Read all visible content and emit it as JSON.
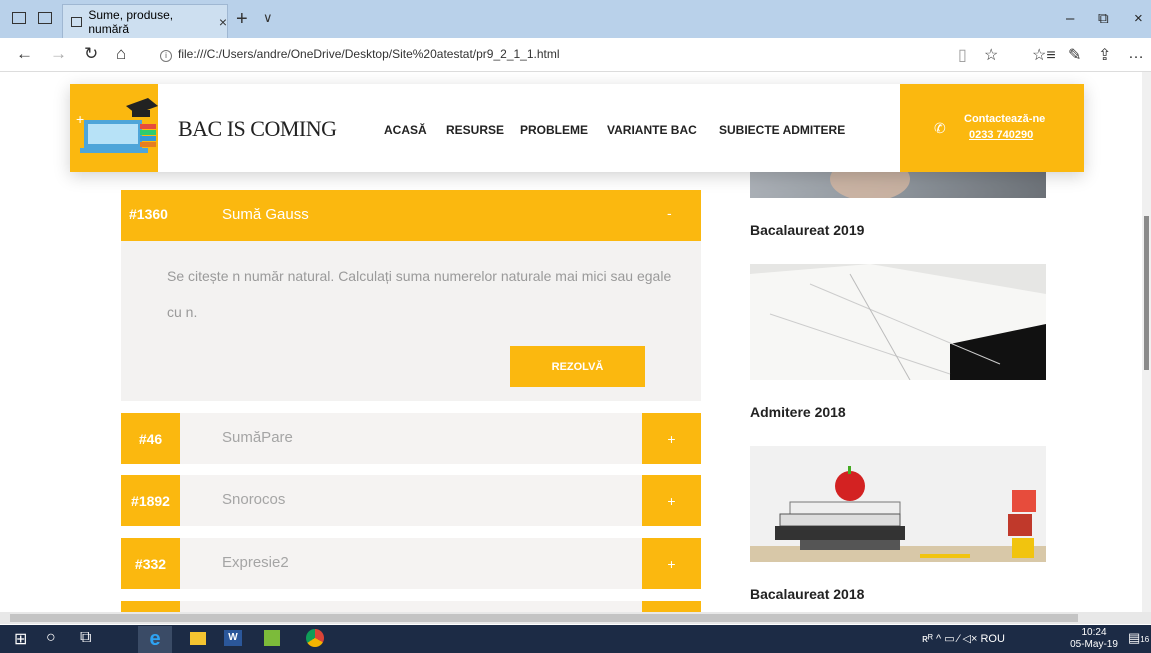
{
  "browser": {
    "tab_title": "Sume, produse, numără",
    "tab_close": "×",
    "new_tab": "+",
    "tab_menu": "∨",
    "url": "file:///C:/Users/andre/OneDrive/Desktop/Site%20atestat/pr9_2_1_1.html",
    "win_min": "–",
    "win_restore": "⧉",
    "win_close": "×",
    "nav_back": "←",
    "nav_forward": "→",
    "nav_refresh": "↻",
    "nav_home": "⌂",
    "tool_reading": "▯",
    "tool_star": "☆",
    "tool_favorites": "☆≡",
    "tool_notes": "✎",
    "tool_share": "⇪",
    "tool_more": "…"
  },
  "header": {
    "brand": "BAC IS COMING",
    "menu": [
      "ACASĂ",
      "RESURSE",
      "PROBLEME",
      "VARIANTE BAC",
      "SUBIECTE ADMITERE"
    ],
    "contact_label": "Contactează-ne",
    "contact_phone": "0233 740290"
  },
  "expanded_problem": {
    "id": "#1360",
    "name": "Sumă Gauss",
    "toggle": "-",
    "text": "Se citește n număr natural. Calculați suma numerelor naturale mai mici sau egale cu n.",
    "solve_label": "REZOLVĂ"
  },
  "problems": [
    {
      "id": "#46",
      "name": "SumăPare",
      "toggle": "+"
    },
    {
      "id": "#1892",
      "name": "Snorocos",
      "toggle": "+"
    },
    {
      "id": "#332",
      "name": "Expresie2",
      "toggle": "+"
    }
  ],
  "sidebar": {
    "cards": [
      {
        "title": "Bacalaureat 2019"
      },
      {
        "title": "Admitere 2018"
      },
      {
        "title": "Bacalaureat 2018"
      }
    ]
  },
  "taskbar": {
    "tray": "ʀᴿ  ^  ▭  ⁄  ◁×  ROU",
    "time": "10:24",
    "date": "05-May-19",
    "notification_count": "16"
  },
  "colors": {
    "accent": "#fbb80f",
    "problem_bg": "#f5f3f2",
    "taskbar": "#1c2b45"
  }
}
